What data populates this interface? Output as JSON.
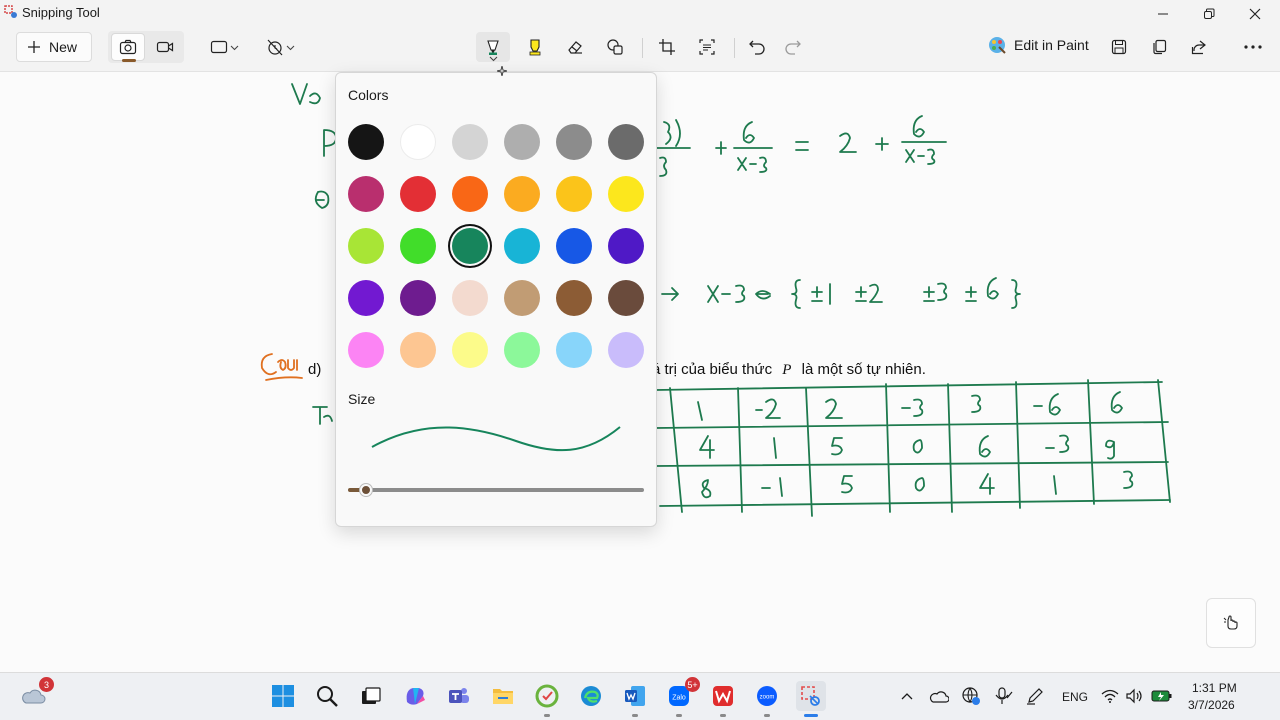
{
  "window": {
    "title": "Snipping Tool"
  },
  "toolbar": {
    "new_label": "New",
    "edit_in_paint_label": "Edit in Paint"
  },
  "popup": {
    "colors_heading": "Colors",
    "size_heading": "Size",
    "selected_color": "#17855c",
    "size_value": 0.06,
    "colors": [
      "#151515",
      "#ffffff",
      "#d4d4d4",
      "#aeaeae",
      "#8c8c8c",
      "#6b6b6b",
      "#b92f6e",
      "#e32f35",
      "#f96716",
      "#fbab20",
      "#fbc41a",
      "#fce71d",
      "#a8e536",
      "#41dd2a",
      "#17855c",
      "#18b4d6",
      "#1758e6",
      "#4f19c6",
      "#7219d1",
      "#6e1c8f",
      "#f3dacf",
      "#c19c74",
      "#8c5c35",
      "#6a4b3c",
      "#fc84f4",
      "#fdc692",
      "#fcfb8a",
      "#8cf89a",
      "#88d5fa",
      "#c9bcfb"
    ]
  },
  "canvas": {
    "line_d_label": "d)",
    "question_text": "á trị của biểu thức",
    "question_var": "P",
    "question_tail": "là một số tự nhiên.",
    "ink_color": "#1e7a4e"
  },
  "taskbar": {
    "weather_badge": "3",
    "zalo_badge": "5+",
    "lang": "ENG",
    "time": "1:31 PM",
    "date": "3/7/2026"
  }
}
